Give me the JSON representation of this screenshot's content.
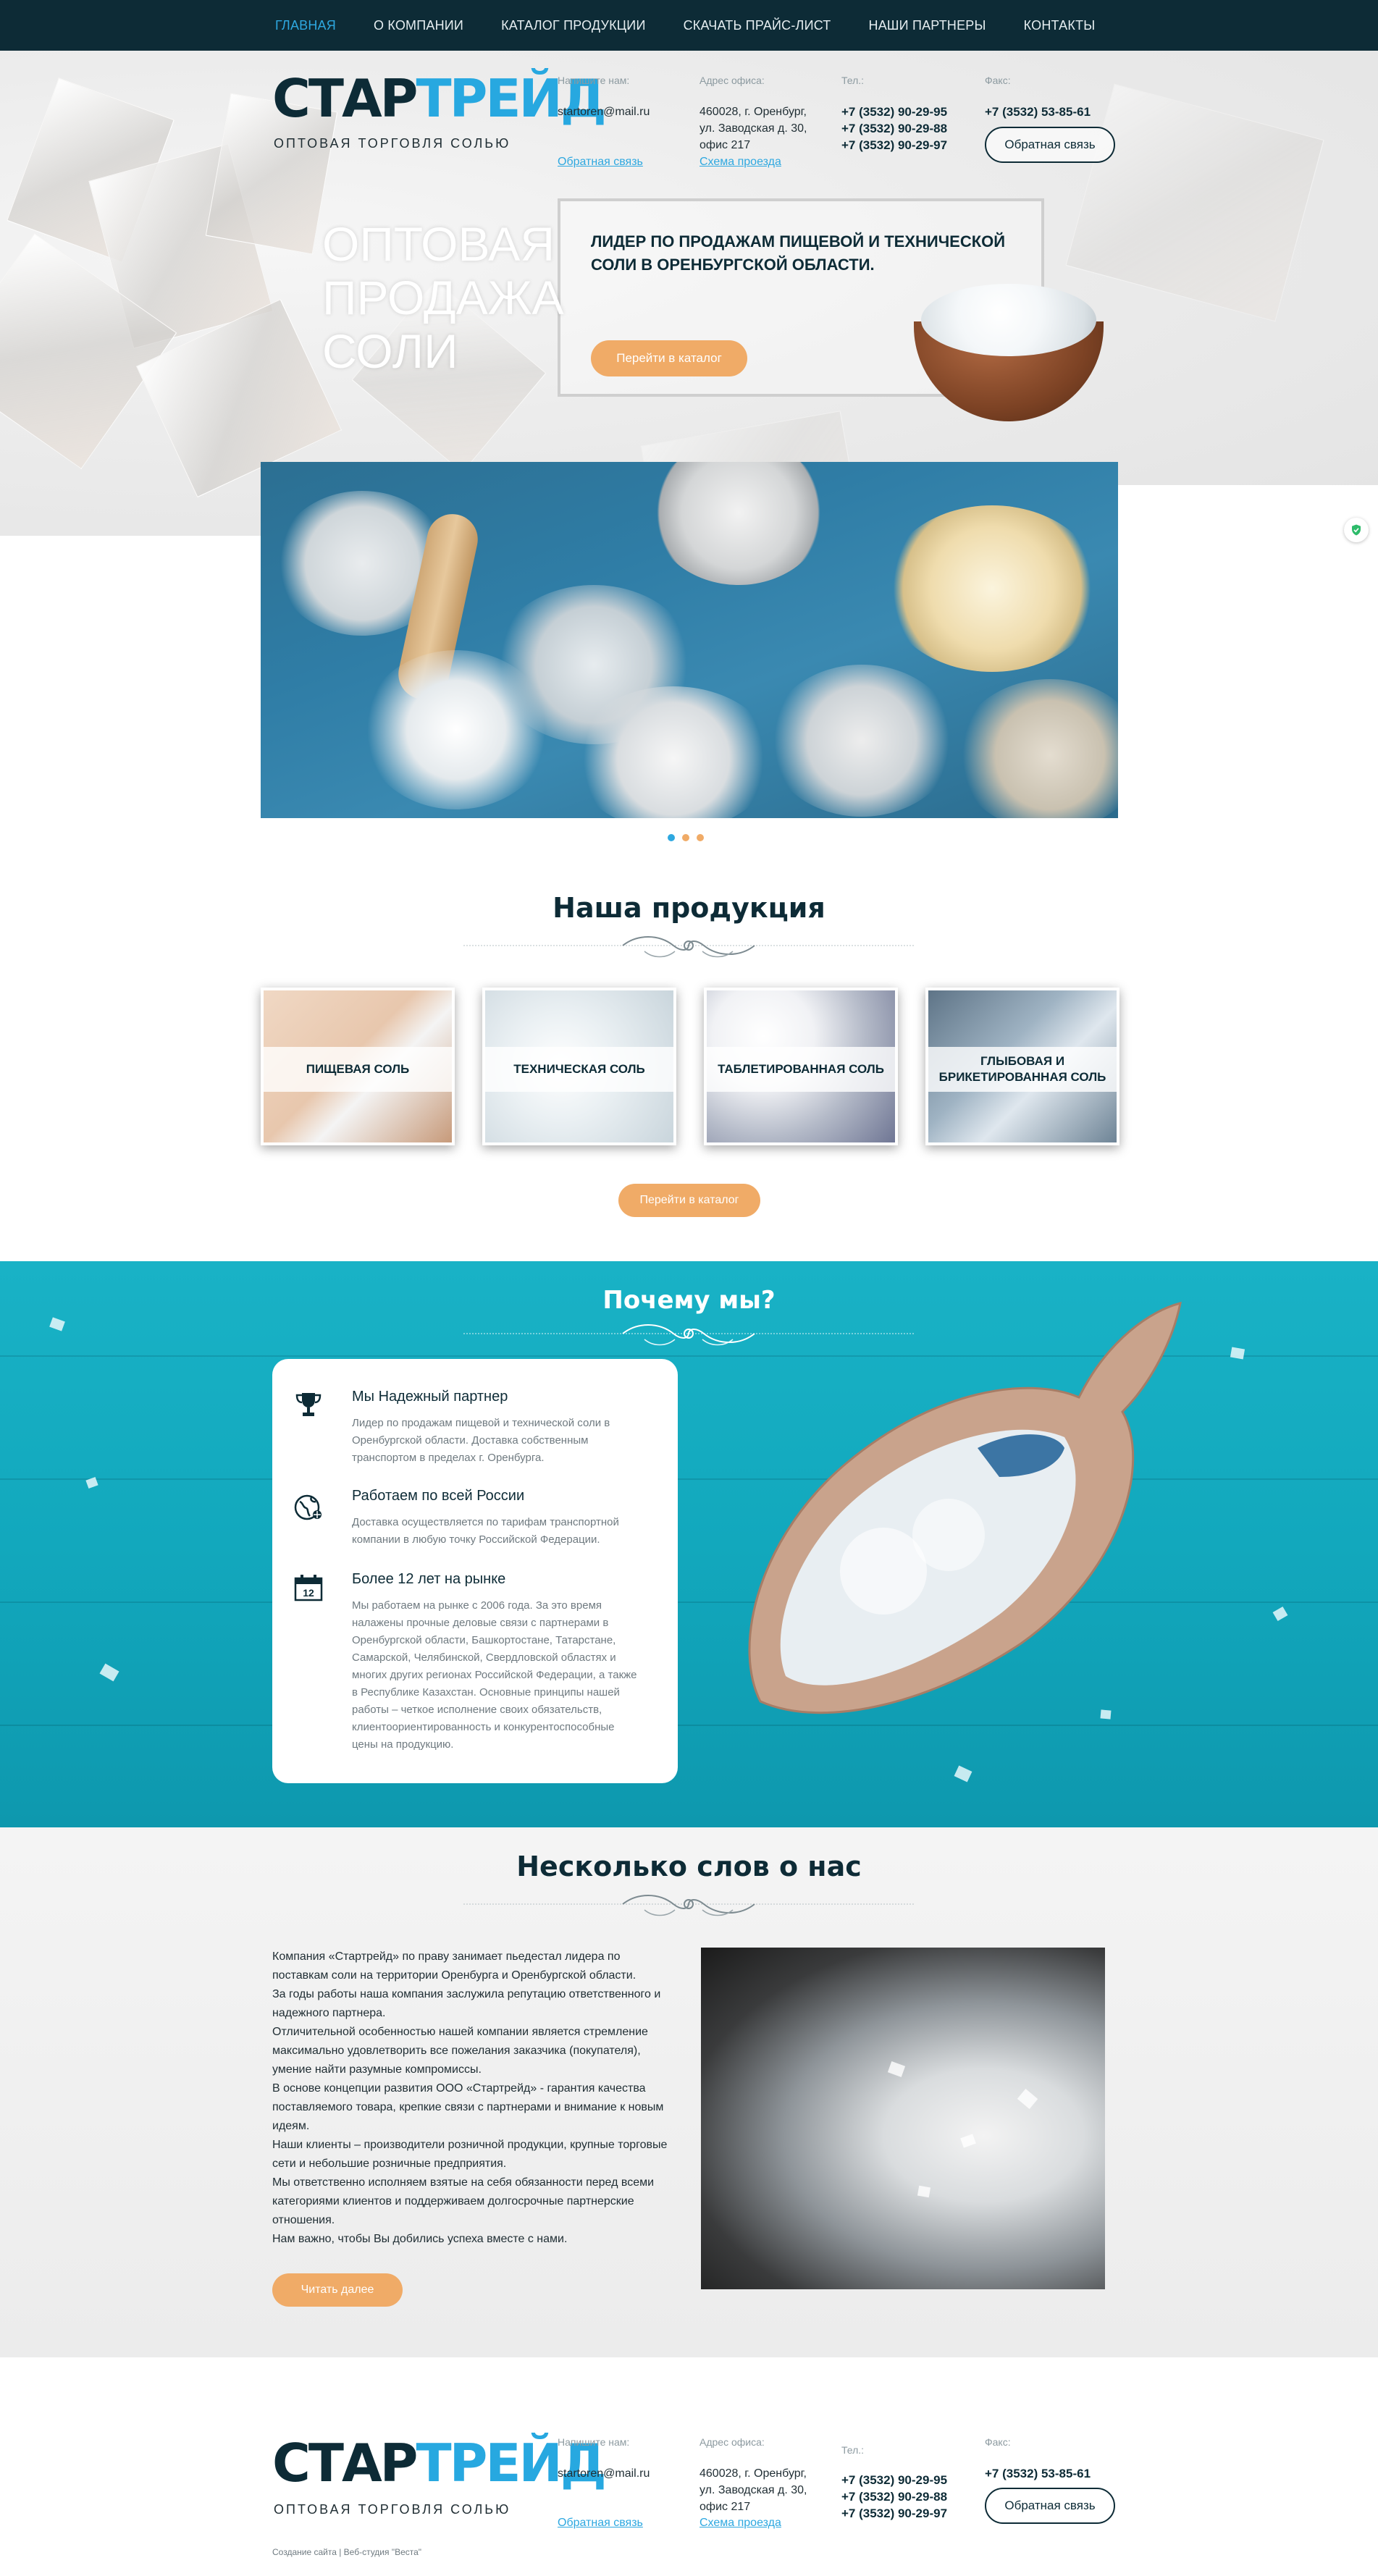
{
  "nav": {
    "items": [
      "ГЛАВНАЯ",
      "О КОМПАНИИ",
      "КАТАЛОГ ПРОДУКЦИИ",
      "СКАЧАТЬ ПРАЙС-ЛИСТ",
      "НАШИ ПАРТНЕРЫ",
      "КОНТАКТЫ"
    ],
    "active_index": 0
  },
  "brand": {
    "logo_part1": "СТАР",
    "logo_part2": "ТРЕЙД",
    "tagline": "ОПТОВАЯ ТОРГОВЛЯ СОЛЬЮ"
  },
  "contacts": {
    "email_label": "Напишите нам:",
    "email": "startoren@mail.ru",
    "feedback_link": "Обратная связь",
    "address_label": "Адрес офиса:",
    "address_line1": "460028, г. Оренбург,",
    "address_line2": "ул. Заводская д. 30,",
    "address_line3": "офис 217",
    "map_link": "Схема проезда",
    "phone_label": "Тел.:",
    "phones": [
      "+7 (3532) 90-29-95",
      "+7 (3532) 90-29-88",
      "+7 (3532) 90-29-97"
    ],
    "fax_label": "Факс:",
    "fax": "+7 (3532) 53-85-61",
    "callback_button": "Обратная связь"
  },
  "hero": {
    "title_line1": "ОПТОВАЯ",
    "title_line2": "ПРОДАЖА",
    "title_line3": "СОЛИ",
    "subtitle": "ЛИДЕР ПО ПРОДАЖАМ ПИЩЕВОЙ И ТЕХНИЧЕСКОЙ СОЛИ В ОРЕНБУРГСКОЙ ОБЛАСТИ.",
    "catalog_button": "Перейти в каталог"
  },
  "slider": {
    "dot_colors": [
      "#2ea8e0",
      "#f0ab67",
      "#f0ab67"
    ],
    "active_index": 0
  },
  "products": {
    "title": "Наша продукция",
    "items": [
      "ПИЩЕВАЯ СОЛЬ",
      "ТЕХНИЧЕСКАЯ СОЛЬ",
      "ТАБЛЕТИРОВАННАЯ СОЛЬ",
      "ГЛЫБОВАЯ И БРИКЕТИРОВАННАЯ СОЛЬ"
    ],
    "catalog_button": "Перейти в каталог"
  },
  "why": {
    "title": "Почему мы?",
    "items": [
      {
        "icon": "trophy-icon",
        "title": "Мы Надежный партнер",
        "text": "Лидер по продажам пищевой и технической соли в Оренбургской области. Доставка собственным транспортом в пределах г. Оренбурга."
      },
      {
        "icon": "globe-icon",
        "title": "Работаем по всей России",
        "text": "Доставка осуществляется по тарифам транспортной компании в любую точку Российской Федерации."
      },
      {
        "icon": "calendar-icon",
        "title": "Более 12 лет на рынке",
        "text": "Мы работаем на рынке с 2006 года. За это время налажены прочные деловые связи с партнерами в Оренбургской области, Башкортостане, Татарстане, Самарской, Челябинской, Свердловской областях и многих других регионах Российской Федерации, а также в Республике Казахстан. Основные принципы нашей работы – четкое исполнение своих обязательств, клиентоориентированность и конкурентоспособные цены на продукцию."
      }
    ],
    "calendar_number": "12"
  },
  "about": {
    "title": "Несколько слов о нас",
    "paragraphs": [
      "Компания «Стартрейд» по праву занимает пьедестал лидера по поставкам соли на территории Оренбурга и Оренбургской области.",
      "За годы работы наша компания заслужила репутацию ответственного и надежного партнера.",
      "Отличительной особенностью нашей компании является стремление максимально удовлетворить все пожелания заказчика (покупателя), умение найти разумные компромиссы.",
      "В основе концепции развития ООО «Стартрейд» - гарантия качества поставляемого товара, крепкие связи с партнерами и внимание к новым идеям.",
      "Наши клиенты – производители розничной продукции, крупные торговые сети и небольшие розничные предприятия.",
      "Мы ответственно исполняем взятые на себя обязанности перед всеми категориями клиентов и поддерживаем долгосрочные партнерские отношения.",
      "Нам важно, чтобы Вы добились успеха вместе с нами."
    ],
    "read_more_button": "Читать далее"
  },
  "footer": {
    "copyright": "Создание сайта | Веб-студия \"Веста\""
  },
  "colors": {
    "navy": "#0d2b36",
    "accent_blue": "#2ea8e0",
    "orange": "#f0ab67",
    "turquoise": "#12a8bd"
  }
}
